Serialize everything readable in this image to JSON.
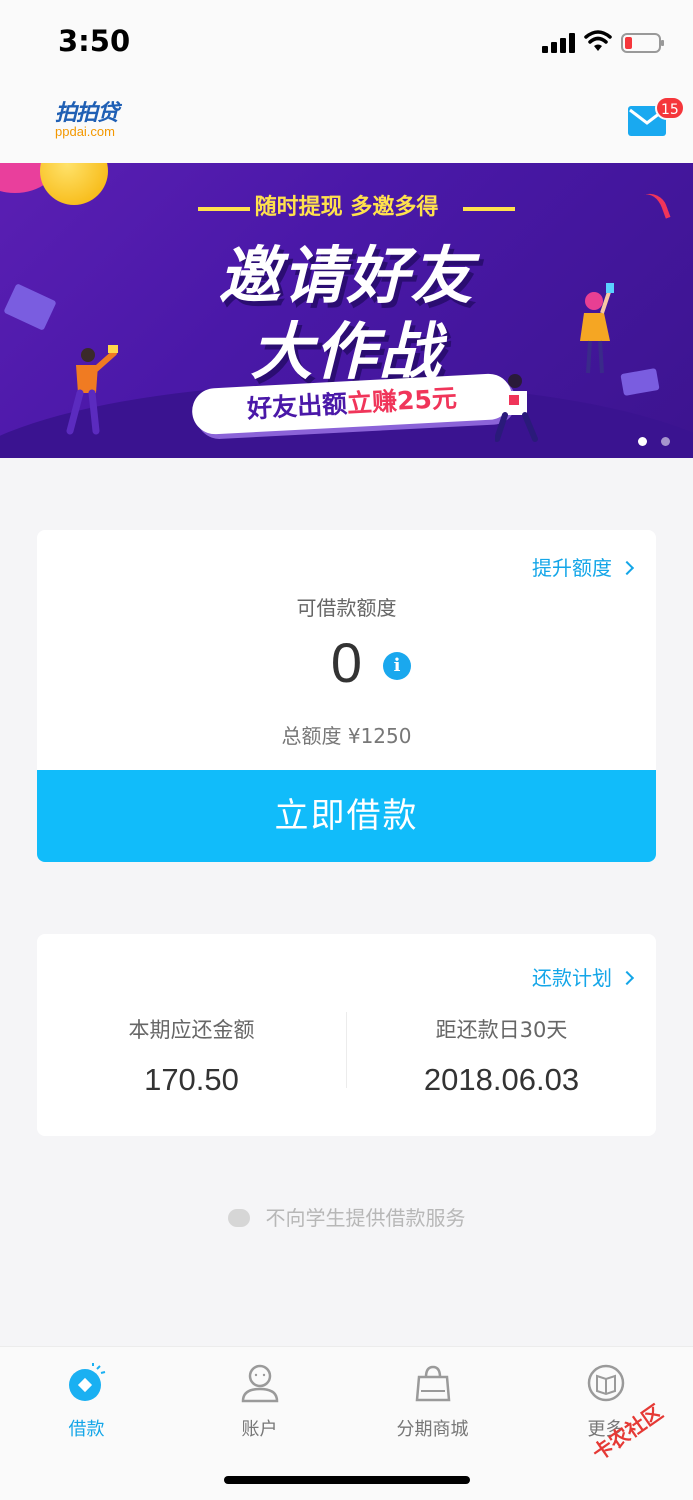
{
  "status_bar": {
    "time": "3:50"
  },
  "header": {
    "logo_text": "拍拍贷",
    "logo_sub": "ppdai.com",
    "mail_badge": "15"
  },
  "banner": {
    "subtitle": "随时提现 多邀多得",
    "title_line1": "邀请好友",
    "title_line2": "大作战",
    "pill_prefix": "好友出额",
    "pill_highlight": "立赚25元",
    "active_dot": 0,
    "dot_count": 2
  },
  "credit": {
    "raise_link": "提升额度",
    "available_label": "可借款额度",
    "available_amount": "0",
    "info": "i",
    "total_label": "总额度 ¥1250",
    "borrow_button": "立即借款"
  },
  "repay": {
    "plan_link": "还款计划",
    "due_label": "本期应还金额",
    "due_amount": "170.50",
    "days_label": "距还款日30天",
    "due_date": "2018.06.03"
  },
  "notice": "不向学生提供借款服务",
  "tabs": [
    {
      "label": "借款",
      "icon": "loan-icon",
      "active": true
    },
    {
      "label": "账户",
      "icon": "account-icon",
      "active": false
    },
    {
      "label": "分期商城",
      "icon": "shopping-bag-icon",
      "active": false
    },
    {
      "label": "更多",
      "icon": "more-book-icon",
      "active": false
    }
  ],
  "watermark": "卡农社区",
  "colors": {
    "accent": "#11bcfa",
    "link": "#14a6e8",
    "badge": "#f5363b",
    "banner": "#4a18a8"
  }
}
